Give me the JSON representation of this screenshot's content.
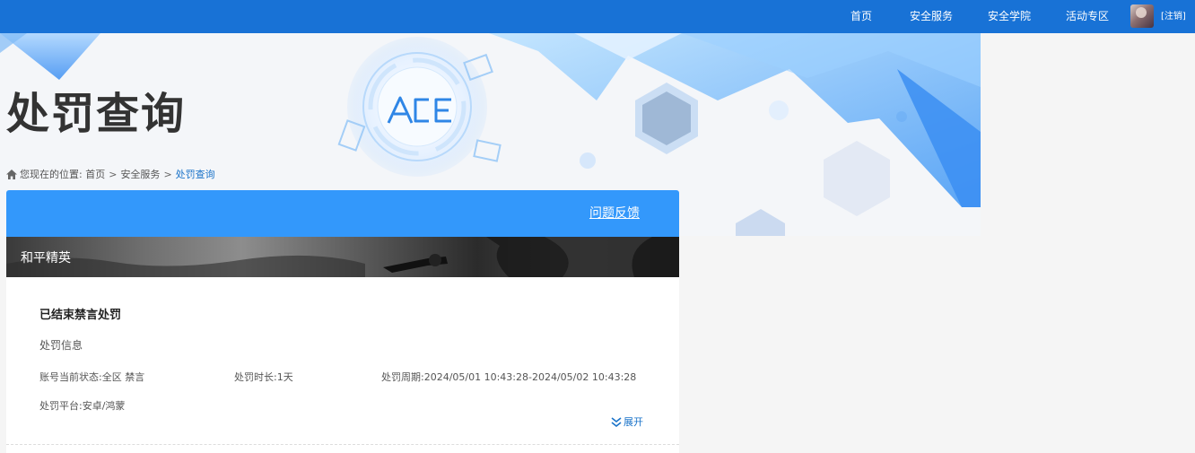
{
  "nav": {
    "items": [
      "首页",
      "安全服务",
      "安全学院",
      "活动专区"
    ],
    "logout": "[注销]"
  },
  "page": {
    "title": "处罚查询"
  },
  "breadcrumb": {
    "prefix": "您现在的位置:",
    "items": [
      "首页",
      "安全服务",
      "处罚查询"
    ],
    "separator": ">"
  },
  "card": {
    "feedback": "问题反馈",
    "game": "和平精英",
    "section_title": "已结束禁言处罚",
    "section_subtitle": "处罚信息",
    "status": "账号当前状态:全区 禁言",
    "duration": "处罚时长:1天",
    "period": "处罚周期:2024/05/01 10:43:28-2024/05/02 10:43:28",
    "platform": "处罚平台:安卓/鸿蒙",
    "expand": "展开"
  },
  "colors": {
    "topbar": "#1872d6",
    "card_header": "#3398fb",
    "link": "#1a73c9"
  },
  "icons": [
    "home-icon",
    "double-chevron-down-icon",
    "ace-logo-icon",
    "avatar"
  ]
}
